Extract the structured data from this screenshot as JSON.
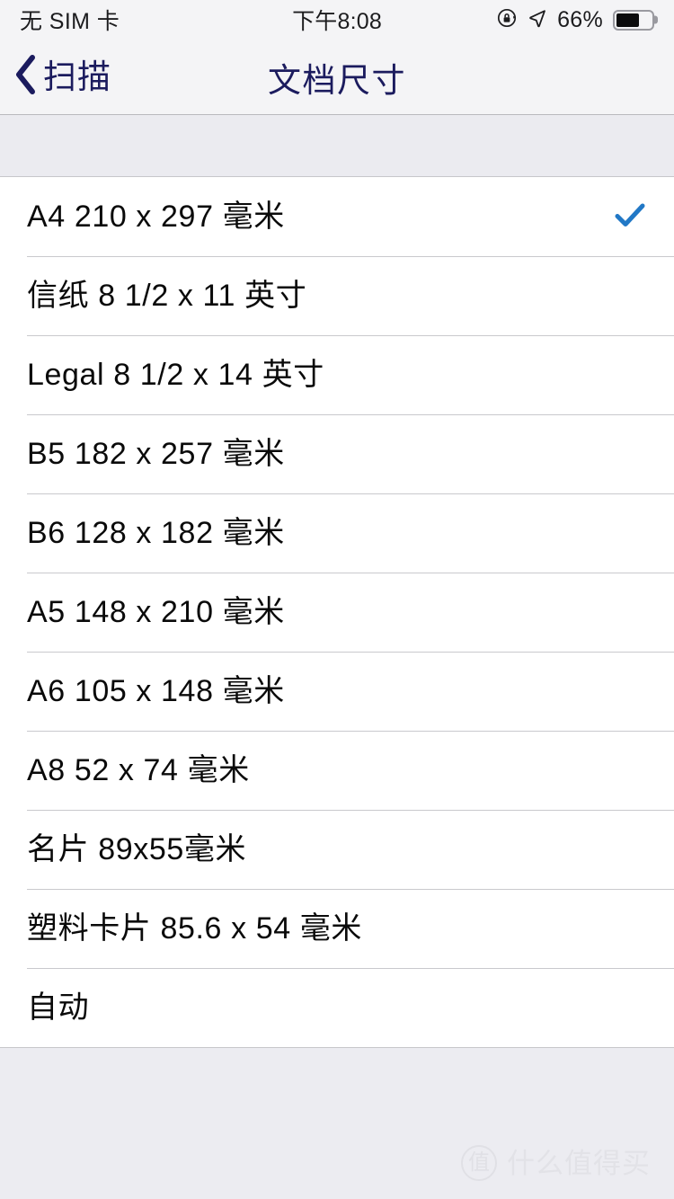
{
  "status_bar": {
    "carrier": "无 SIM 卡",
    "time": "下午8:08",
    "battery_percent": "66%",
    "battery_level": 66,
    "rotation_lock_icon": "rotation-lock-icon",
    "location_icon": "location-arrow-icon",
    "battery_icon": "battery-icon"
  },
  "nav_bar": {
    "back_label": "扫描",
    "back_icon": "chevron-left-icon",
    "title": "文档尺寸",
    "tint_color": "#1b1b5e"
  },
  "list": {
    "selected_index": 0,
    "check_icon": "checkmark-icon",
    "check_color": "#2178c6",
    "items": [
      {
        "label": "A4 210 x 297 毫米",
        "selected": true
      },
      {
        "label": "信纸 8 1/2 x 11 英寸",
        "selected": false
      },
      {
        "label": "Legal 8 1/2 x 14 英寸",
        "selected": false
      },
      {
        "label": "B5 182 x 257 毫米",
        "selected": false
      },
      {
        "label": "B6 128 x 182 毫米",
        "selected": false
      },
      {
        "label": "A5 148 x 210 毫米",
        "selected": false
      },
      {
        "label": "A6 105 x 148 毫米",
        "selected": false
      },
      {
        "label": "A8 52 x 74 毫米",
        "selected": false
      },
      {
        "label": "名片 89x55毫米",
        "selected": false
      },
      {
        "label": "塑料卡片 85.6 x 54 毫米",
        "selected": false
      },
      {
        "label": "自动",
        "selected": false
      }
    ]
  },
  "watermark": {
    "logo_glyph": "值",
    "text": "什么值得买"
  },
  "colors": {
    "background": "#ececf1",
    "chrome": "#f4f4f6",
    "row_background": "#ffffff",
    "separator": "#c9c9cd",
    "text_primary": "#0a0a0a"
  }
}
